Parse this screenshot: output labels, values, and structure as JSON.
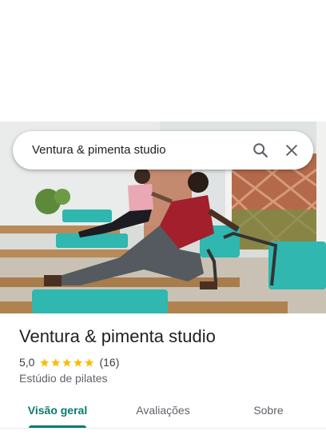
{
  "search": {
    "query": "Ventura & pimenta studio",
    "search_icon": "search-icon",
    "close_icon": "close-icon"
  },
  "place": {
    "name": "Ventura & pimenta studio",
    "rating": "5,0",
    "stars": 5,
    "review_count": "(16)",
    "category": "Estúdio de pilates"
  },
  "tabs": [
    {
      "label": "Visão geral",
      "active": true
    },
    {
      "label": "Avaliações",
      "active": false
    },
    {
      "label": "Sobre",
      "active": false
    }
  ],
  "colors": {
    "accent": "#0b7a6f",
    "star": "#fbbc04",
    "reformer_bed": "#2fb7b0"
  }
}
